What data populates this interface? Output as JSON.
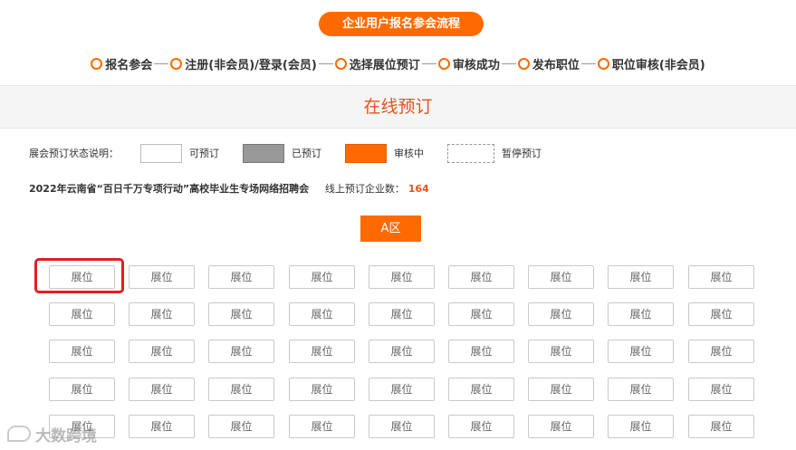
{
  "header": {
    "flow_button_label": "企业用户报名参会流程"
  },
  "steps": [
    {
      "label": "报名参会"
    },
    {
      "label": "注册(非会员)/登录(会员)"
    },
    {
      "label": "选择展位预订"
    },
    {
      "label": "审核成功"
    },
    {
      "label": "发布职位"
    },
    {
      "label": "职位审核(非会员)"
    }
  ],
  "banner": {
    "title": "在线预订"
  },
  "legend": {
    "title": "展会预订状态说明：",
    "available": "可预订",
    "booked": "已预订",
    "reviewing": "审核中",
    "paused": "暂停预订"
  },
  "fair": {
    "name": "2022年云南省“百日千万专项行动”高校毕业生专场网络招聘会",
    "count_label": "线上预订企业数：",
    "count": "164"
  },
  "zone": {
    "label": "A区"
  },
  "booths": {
    "rows": 5,
    "cols": 9,
    "label": "展位"
  },
  "watermark": {
    "text": "大数跨境"
  },
  "colors": {
    "accent": "#ff6a00",
    "highlight": "#e31e1e",
    "title": "#e8511e"
  }
}
